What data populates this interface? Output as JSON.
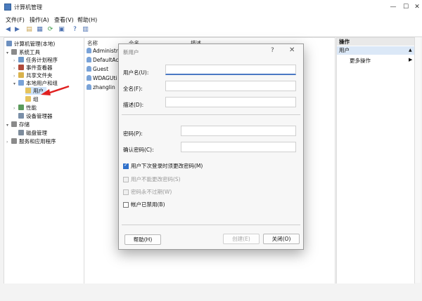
{
  "window": {
    "title": "计算机管理"
  },
  "menubar": {
    "items": [
      "文件(F)",
      "操作(A)",
      "查看(V)",
      "帮助(H)"
    ]
  },
  "toolbar": {
    "icons": [
      "back-icon",
      "forward-icon",
      "up-folder-icon",
      "properties-icon",
      "console-tree-icon",
      "refresh-icon",
      "help-icon",
      "show-hide-icon"
    ]
  },
  "tree": {
    "root": "计算机管理(本地)",
    "system_tools": "系统工具",
    "task_scheduler": "任务计划程序",
    "event_viewer": "事件查看器",
    "shared_folders": "共享文件夹",
    "local_users": "本地用户和组",
    "users": "用户",
    "groups": "组",
    "performance": "性能",
    "device_manager": "设备管理器",
    "storage": "存储",
    "disk_management": "磁盘管理",
    "services": "服务和应用程序"
  },
  "list": {
    "headers": [
      "名称",
      "全名",
      "描述"
    ],
    "rows": [
      "Administr",
      "DefaultAc",
      "Guest",
      "WDAGUti",
      "zhanglin"
    ]
  },
  "actions": {
    "header": "操作",
    "section": "用户",
    "more": "更多操作"
  },
  "dialog": {
    "title": "新用户",
    "help": "?",
    "close": "✕",
    "username_label": "用户名(U):",
    "fullname_label": "全名(F):",
    "description_label": "描述(D):",
    "password_label": "密码(P):",
    "confirm_label": "确认密码(C):",
    "options": [
      {
        "label": "用户下次登录时须更改密码(M)",
        "checked": true,
        "disabled": false
      },
      {
        "label": "用户不能更改密码(S)",
        "checked": false,
        "disabled": true
      },
      {
        "label": "密码永不过期(W)",
        "checked": false,
        "disabled": true
      },
      {
        "label": "帐户已禁用(B)",
        "checked": false,
        "disabled": false
      }
    ],
    "help_button": "帮助(H)",
    "create_button": "创建(E)",
    "close_button": "关闭(O)"
  },
  "colors": {
    "accent": "#2e6fc9",
    "selection": "#cfe3fa",
    "arrow": "#e02020"
  }
}
